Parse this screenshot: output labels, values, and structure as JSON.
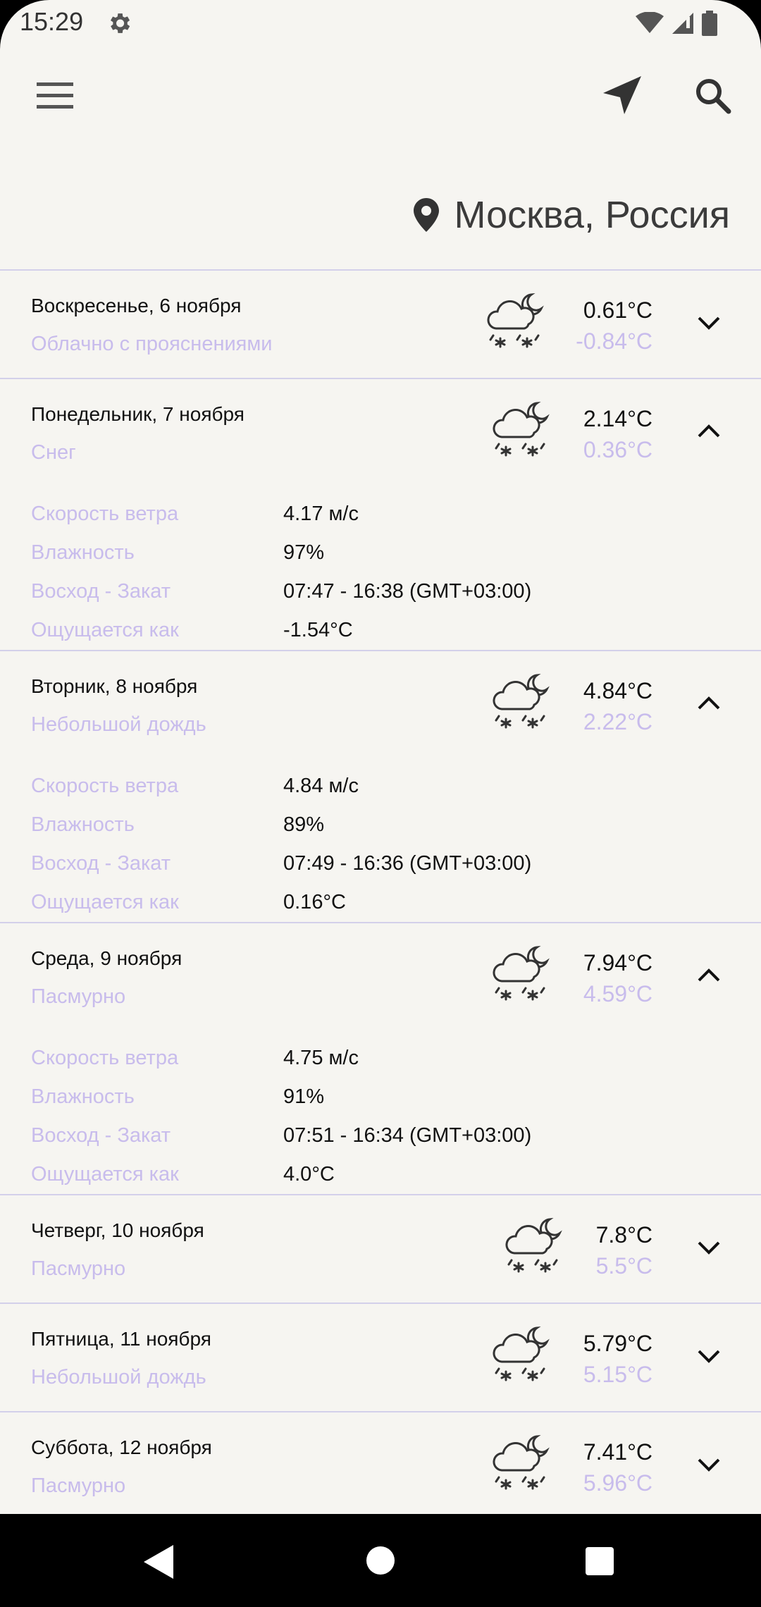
{
  "status_bar": {
    "time": "15:29"
  },
  "location": {
    "label": "Москва, Россия"
  },
  "detail_labels": {
    "wind": "Скорость ветра",
    "humidity": "Влажность",
    "sun": "Восход - Закат",
    "feels": "Ощущается как"
  },
  "days": [
    {
      "date": "Воскресенье, 6 ноября",
      "condition": "Облачно с прояснениями",
      "t_max": "0.61°C",
      "t_min": "-0.84°C",
      "expanded": false
    },
    {
      "date": "Понедельник, 7 ноября",
      "condition": "Снег",
      "t_max": "2.14°C",
      "t_min": "0.36°C",
      "expanded": true,
      "wind": "4.17 м/с",
      "humidity": "97%",
      "sun": "07:47 - 16:38 (GMT+03:00)",
      "feels": "-1.54°C"
    },
    {
      "date": "Вторник, 8 ноября",
      "condition": "Небольшой дождь",
      "t_max": "4.84°C",
      "t_min": "2.22°C",
      "expanded": true,
      "wind": "4.84 м/с",
      "humidity": "89%",
      "sun": "07:49 - 16:36 (GMT+03:00)",
      "feels": "0.16°C"
    },
    {
      "date": "Среда, 9 ноября",
      "condition": "Пасмурно",
      "t_max": "7.94°C",
      "t_min": "4.59°C",
      "expanded": true,
      "wind": "4.75 м/с",
      "humidity": "91%",
      "sun": "07:51 - 16:34 (GMT+03:00)",
      "feels": "4.0°C"
    },
    {
      "date": "Четверг, 10 ноября",
      "condition": "Пасмурно",
      "t_max": "7.8°C",
      "t_min": "5.5°C",
      "expanded": false
    },
    {
      "date": "Пятница, 11 ноября",
      "condition": "Небольшой дождь",
      "t_max": "5.79°C",
      "t_min": "5.15°C",
      "expanded": false
    },
    {
      "date": "Суббота, 12 ноября",
      "condition": "Пасмурно",
      "t_max": "7.41°C",
      "t_min": "5.96°C",
      "expanded": false
    }
  ],
  "icons": {
    "menu": "menu-icon",
    "navigate": "navigation-arrow-icon",
    "search": "search-icon",
    "location_pin": "location-pin-icon",
    "weather": "cloud-moon-snow-icon",
    "expand": "chevron-down-icon",
    "collapse": "chevron-up-icon"
  },
  "colors": {
    "background": "#f6f5f1",
    "accent_text": "#c8bcec",
    "divider": "#d3d0ea"
  }
}
